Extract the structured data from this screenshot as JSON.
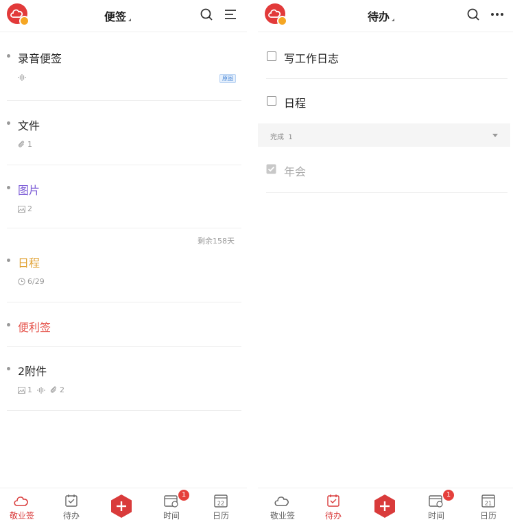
{
  "left": {
    "title": "便签",
    "notes": [
      {
        "title": "录音便签",
        "color": "#222222",
        "tag": "原图"
      },
      {
        "title": "文件",
        "color": "#222222",
        "attach_count": "1"
      },
      {
        "title": "图片",
        "color": "#7c5cd6",
        "image_count": "2"
      },
      {
        "title": "日程",
        "color": "#e0a030",
        "remaining": "剩余158天",
        "date": "6/29"
      },
      {
        "title": "便利签",
        "color": "#e5534b"
      },
      {
        "title": "2附件",
        "color": "#222222",
        "image_count": "1",
        "attach_count": "2"
      }
    ],
    "tabs": [
      {
        "label": "敬业签",
        "icon": "cloud-icon",
        "active": true
      },
      {
        "label": "待办",
        "icon": "todo-check-icon",
        "active": false
      },
      {
        "label": "",
        "icon": "add-icon"
      },
      {
        "label": "时间",
        "icon": "time-icon",
        "badge": "1",
        "active": false
      },
      {
        "label": "日历",
        "icon": "calendar-icon",
        "day": "22",
        "active": false
      }
    ]
  },
  "right": {
    "title": "待办",
    "todos": [
      {
        "label": "写工作日志",
        "done": false
      },
      {
        "label": "日程",
        "done": false
      }
    ],
    "done_section": {
      "label": "完成",
      "count": "1"
    },
    "done_items": [
      {
        "label": "年会",
        "done": true
      }
    ],
    "tabs": [
      {
        "label": "敬业签",
        "icon": "cloud-icon",
        "active": false
      },
      {
        "label": "待办",
        "icon": "todo-check-icon",
        "active": true
      },
      {
        "label": "",
        "icon": "add-icon"
      },
      {
        "label": "时间",
        "icon": "time-icon",
        "badge": "1",
        "active": false
      },
      {
        "label": "日历",
        "icon": "calendar-icon",
        "day": "21",
        "active": false
      }
    ]
  },
  "colors": {
    "accent": "#d93b3b",
    "badge": "#e5403c",
    "purple": "#7c5cd6",
    "orange": "#e0a030",
    "red": "#e5534b"
  }
}
